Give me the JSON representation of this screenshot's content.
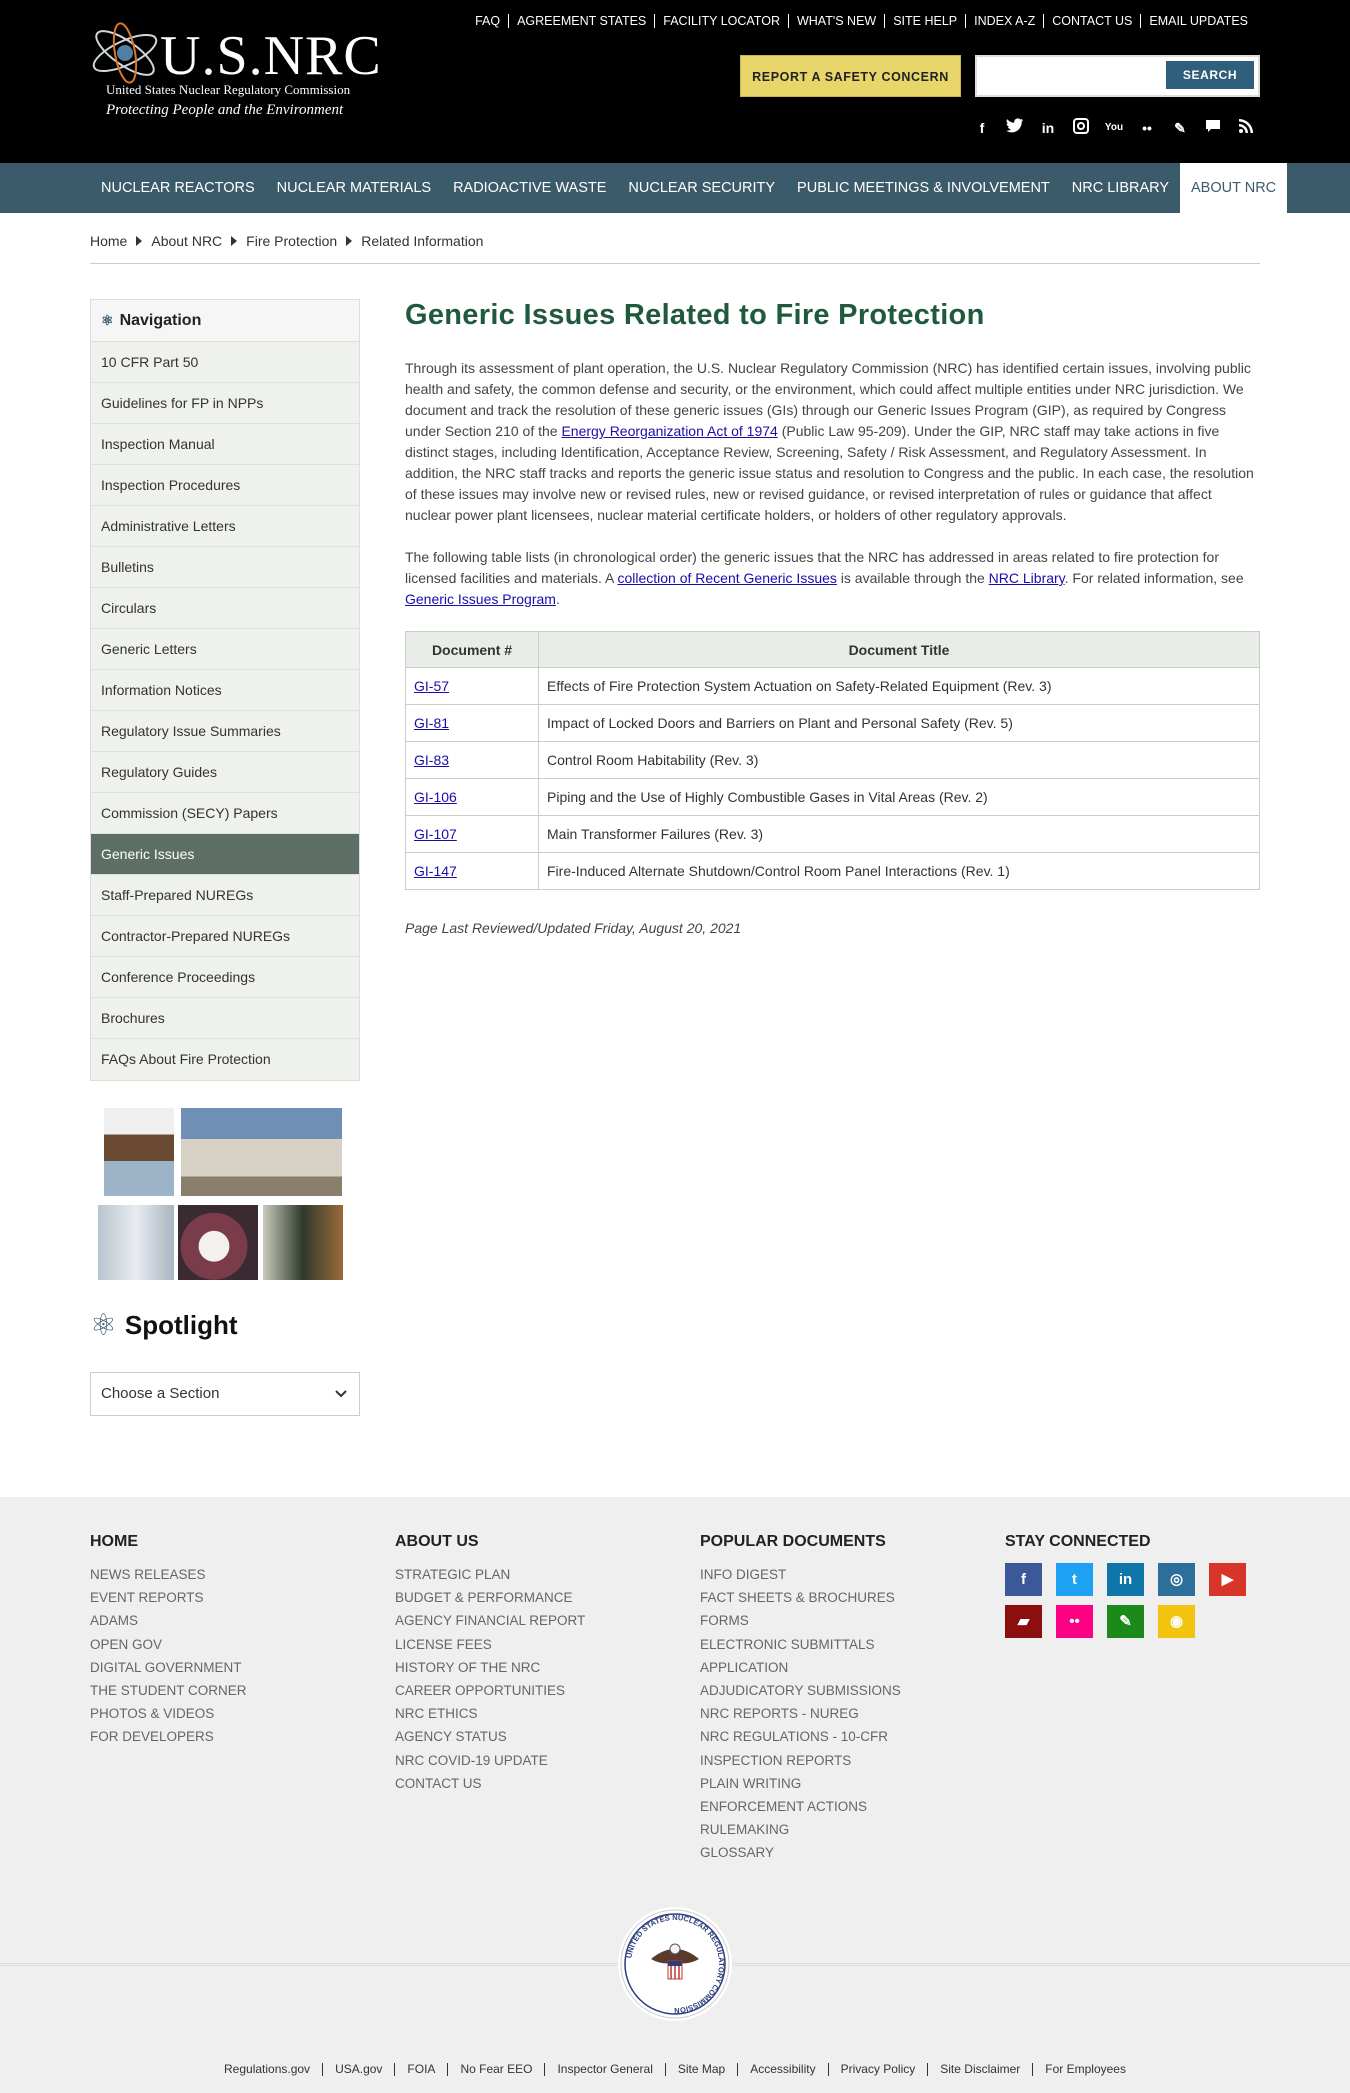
{
  "header": {
    "logo_text": "U.S.NRC",
    "logo_subtitle": "United States Nuclear Regulatory Commission",
    "logo_tagline": "Protecting People and the Environment",
    "top_links": [
      "FAQ",
      "AGREEMENT STATES",
      "FACILITY LOCATOR",
      "WHAT'S NEW",
      "SITE HELP",
      "INDEX A-Z",
      "CONTACT US",
      "EMAIL UPDATES"
    ],
    "report_button": "REPORT A SAFETY CONCERN",
    "search_placeholder": "",
    "search_button": "SEARCH",
    "social_icons": [
      "facebook-icon",
      "twitter-icon",
      "linkedin-icon",
      "instagram-icon",
      "youtube-icon",
      "flickr-icon",
      "blog-icon",
      "comment-icon",
      "rss-icon"
    ]
  },
  "mainnav": {
    "items": [
      "NUCLEAR REACTORS",
      "NUCLEAR MATERIALS",
      "RADIOACTIVE WASTE",
      "NUCLEAR SECURITY",
      "PUBLIC MEETINGS & INVOLVEMENT",
      "NRC LIBRARY",
      "ABOUT NRC"
    ],
    "active": "ABOUT NRC"
  },
  "breadcrumb": [
    "Home",
    "About NRC",
    "Fire Protection",
    "Related Information"
  ],
  "leftnav": {
    "title": "Navigation",
    "items": [
      "10 CFR Part 50",
      "Guidelines for FP in NPPs",
      "Inspection Manual",
      "Inspection Procedures",
      "Administrative Letters",
      "Bulletins",
      "Circulars",
      "Generic Letters",
      "Information Notices",
      "Regulatory Issue Summaries",
      "Regulatory Guides",
      "Commission (SECY) Papers",
      "Generic Issues",
      "Staff-Prepared NUREGs",
      "Contractor-Prepared NUREGs",
      "Conference Proceedings",
      "Brochures",
      "FAQs About Fire Protection"
    ],
    "active": "Generic Issues"
  },
  "spotlight": {
    "title": "Spotlight",
    "select_value": "Choose a Section"
  },
  "content": {
    "title": "Generic Issues Related to Fire Protection",
    "p1_a": "Through its assessment of plant operation, the U.S. Nuclear Regulatory Commission (NRC) has identified certain issues, involving public health and safety, the common defense and security, or the environment, which could affect multiple entities under NRC jurisdiction. We document and track the resolution of these generic issues (GIs) through our Generic Issues Program (GIP), as required by Congress under Section 210 of the ",
    "p1_link": "Energy Reorganization Act of 1974",
    "p1_b": " (Public Law 95-209). Under the GIP, NRC staff may take actions in five distinct stages, including Identification, Acceptance Review, Screening, Safety / Risk Assessment, and Regulatory Assessment. In addition, the NRC staff tracks and reports the generic issue status and resolution to Congress and the public. In each case, the resolution of these issues may involve new or revised rules, new or revised guidance, or revised interpretation of rules or guidance that affect nuclear power plant licensees, nuclear material certificate holders, or holders of other regulatory approvals.",
    "p2_a": "The following table lists (in chronological order) the generic issues that the NRC has addressed in areas related to fire protection for licensed facilities and materials. A ",
    "p2_link1": "collection of Recent Generic Issues",
    "p2_b": " is available through the ",
    "p2_link2": "NRC Library",
    "p2_c": ". For related information, see ",
    "p2_link3": "Generic Issues Program",
    "p2_d": ".",
    "table": {
      "headers": [
        "Document #",
        "Document Title"
      ],
      "rows": [
        [
          "GI-57",
          "Effects of Fire Protection System Actuation on Safety-Related Equipment (Rev. 3)"
        ],
        [
          "GI-81",
          "Impact of Locked Doors and Barriers on Plant and Personal Safety (Rev. 5)"
        ],
        [
          "GI-83",
          "Control Room Habitability (Rev. 3)"
        ],
        [
          "GI-106",
          "Piping and the Use of Highly Combustible Gases in Vital Areas (Rev. 2)"
        ],
        [
          "GI-107",
          "Main Transformer Failures (Rev. 3)"
        ],
        [
          "GI-147",
          "Fire-Induced Alternate Shutdown/Control Room Panel Interactions (Rev. 1)"
        ]
      ]
    },
    "reviewed": "Page Last Reviewed/Updated Friday, August 20, 2021"
  },
  "footer": {
    "col1": {
      "heading": "HOME",
      "links": [
        "NEWS RELEASES",
        "EVENT REPORTS",
        "ADAMS",
        "OPEN GOV",
        "DIGITAL GOVERNMENT",
        "THE STUDENT CORNER",
        "PHOTOS & VIDEOS",
        "FOR DEVELOPERS"
      ]
    },
    "col2": {
      "heading": "ABOUT US",
      "links": [
        "STRATEGIC PLAN",
        "BUDGET & PERFORMANCE",
        "AGENCY FINANCIAL REPORT",
        "LICENSE FEES",
        "HISTORY OF THE NRC",
        "CAREER OPPORTUNITIES",
        "NRC ETHICS",
        "AGENCY STATUS",
        "NRC COVID-19 UPDATE",
        "CONTACT US"
      ]
    },
    "col3": {
      "heading": "POPULAR DOCUMENTS",
      "links": [
        "INFO DIGEST",
        "FACT SHEETS & BROCHURES",
        "FORMS",
        "ELECTRONIC SUBMITTALS",
        "APPLICATION",
        "ADJUDICATORY SUBMISSIONS",
        "NRC REPORTS - NUREG",
        "NRC REGULATIONS - 10-CFR",
        "INSPECTION REPORTS",
        "PLAIN WRITING",
        "ENFORCEMENT ACTIONS",
        "RULEMAKING",
        "GLOSSARY"
      ]
    },
    "col4": {
      "heading": "STAY CONNECTED",
      "icons": [
        {
          "name": "facebook-icon",
          "glyph": "f",
          "color": "#3b5998"
        },
        {
          "name": "twitter-icon",
          "glyph": "t",
          "color": "#1da1f2"
        },
        {
          "name": "linkedin-icon",
          "glyph": "in",
          "color": "#0e76a8"
        },
        {
          "name": "instagram-icon",
          "glyph": "◎",
          "color": "#2d6e9a"
        },
        {
          "name": "youtube-icon",
          "glyph": "▶",
          "color": "#d8352a"
        },
        {
          "name": "comment-icon",
          "glyph": "▰",
          "color": "#8b0f0f"
        },
        {
          "name": "flickr-icon",
          "glyph": "••",
          "color": "#ff0084"
        },
        {
          "name": "blog-icon",
          "glyph": "✎",
          "color": "#1b8a1b"
        },
        {
          "name": "rss-icon",
          "glyph": "◉",
          "color": "#f2c40f"
        }
      ]
    },
    "seal_text": "UNITED STATES NUCLEAR REGULATORY COMMISSION",
    "bottom_links": [
      "Regulations.gov",
      "USA.gov",
      "FOIA",
      "No Fear EEO",
      "Inspector General",
      "Site Map",
      "Accessibility",
      "Privacy Policy",
      "Site Disclaimer",
      "For Employees"
    ]
  }
}
